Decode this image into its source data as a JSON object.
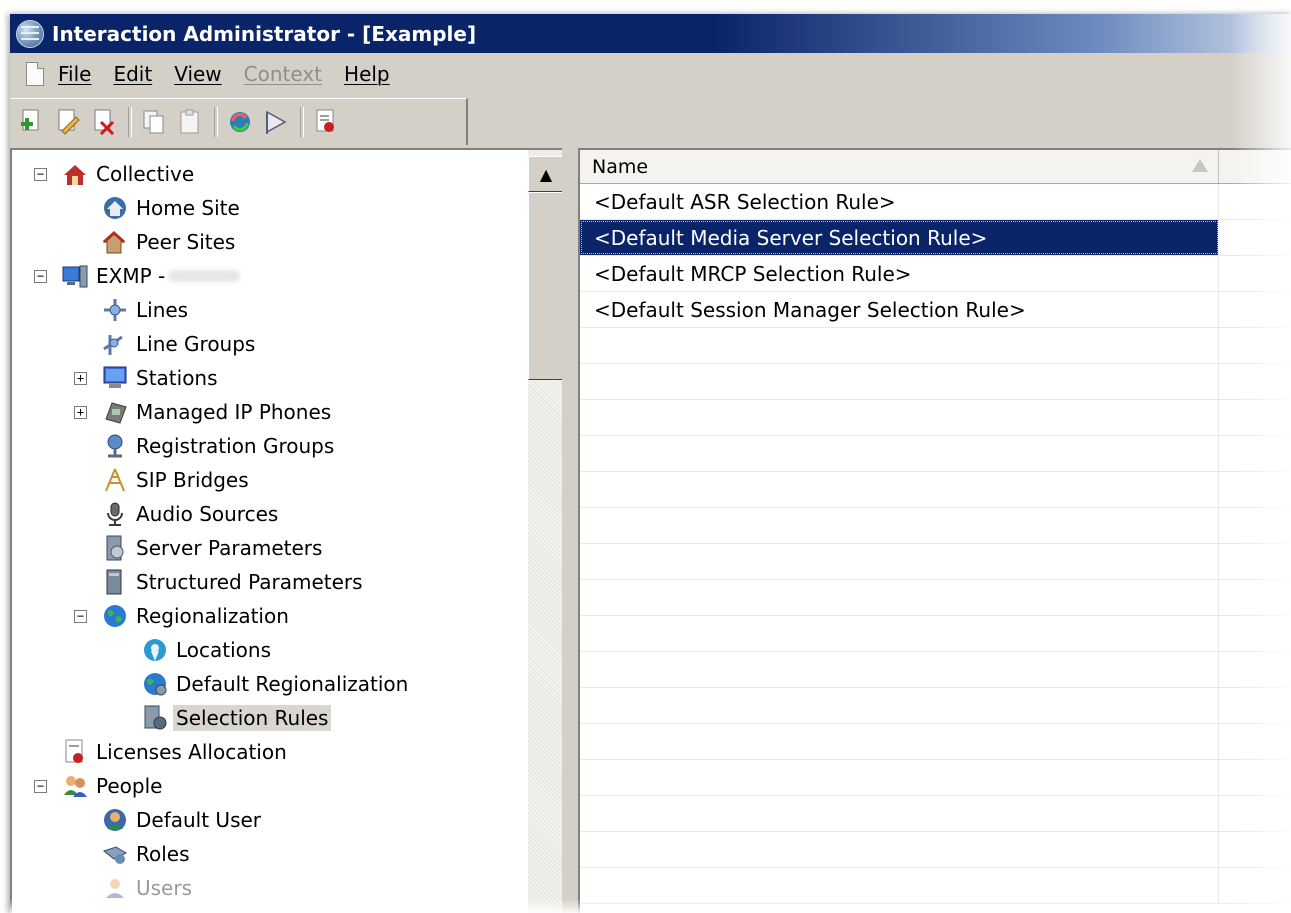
{
  "window": {
    "title": "Interaction Administrator - [Example]"
  },
  "menu": {
    "items": [
      {
        "label": "File",
        "enabled": true
      },
      {
        "label": "Edit",
        "enabled": true
      },
      {
        "label": "View",
        "enabled": true
      },
      {
        "label": "Context",
        "enabled": false
      },
      {
        "label": "Help",
        "enabled": true
      }
    ]
  },
  "toolbar": {
    "buttons": [
      "new-icon",
      "edit-icon",
      "delete-icon",
      "copy-icon",
      "paste-icon",
      "refresh-icon",
      "sign-icon",
      "license-icon"
    ]
  },
  "tree": {
    "items": [
      {
        "label": "Collective",
        "expander": "minus",
        "icon": "collective-icon"
      },
      {
        "label": "Home Site",
        "icon": "home-site-icon"
      },
      {
        "label": "Peer Sites",
        "icon": "peer-sites-icon"
      },
      {
        "label": "EXMP - ",
        "expander": "minus",
        "icon": "server-icon"
      },
      {
        "label": "Lines",
        "icon": "lines-icon"
      },
      {
        "label": "Line Groups",
        "icon": "line-groups-icon"
      },
      {
        "label": "Stations",
        "expander": "plus",
        "icon": "stations-icon"
      },
      {
        "label": "Managed IP Phones",
        "expander": "plus",
        "icon": "phone-icon"
      },
      {
        "label": "Registration Groups",
        "icon": "registration-groups-icon"
      },
      {
        "label": "SIP Bridges",
        "icon": "sip-bridges-icon"
      },
      {
        "label": "Audio Sources",
        "icon": "audio-sources-icon"
      },
      {
        "label": "Server Parameters",
        "icon": "server-parameters-icon"
      },
      {
        "label": "Structured Parameters",
        "icon": "structured-parameters-icon"
      },
      {
        "label": "Regionalization",
        "expander": "minus",
        "icon": "globe-icon"
      },
      {
        "label": "Locations",
        "icon": "locations-icon"
      },
      {
        "label": "Default Regionalization",
        "icon": "default-regionalization-icon"
      },
      {
        "label": "Selection Rules",
        "icon": "selection-rules-icon",
        "selected": true
      },
      {
        "label": "Licenses Allocation",
        "icon": "licenses-icon"
      },
      {
        "label": "People",
        "expander": "minus",
        "icon": "people-icon"
      },
      {
        "label": "Default User",
        "icon": "default-user-icon"
      },
      {
        "label": "Roles",
        "icon": "roles-icon"
      },
      {
        "label": "Users",
        "icon": "users-icon",
        "dimmed": true
      }
    ]
  },
  "list": {
    "column_name": "Name",
    "rows": [
      {
        "name": "<Default ASR Selection Rule>"
      },
      {
        "name": "<Default Media Server Selection Rule>",
        "selected": true
      },
      {
        "name": "<Default MRCP Selection Rule>"
      },
      {
        "name": "<Default Session Manager Selection Rule>"
      }
    ]
  },
  "colors": {
    "title_bar": "#0a246a",
    "selection": "#0a246a",
    "chrome": "#d4d0c8"
  }
}
